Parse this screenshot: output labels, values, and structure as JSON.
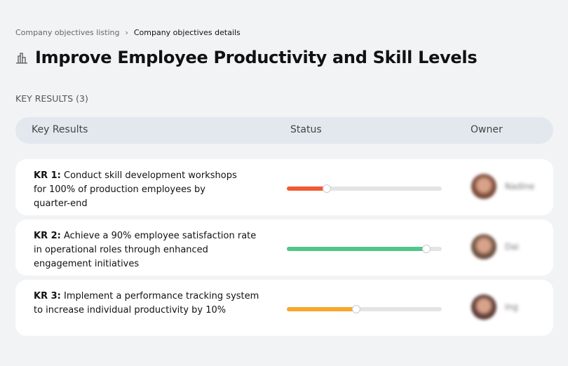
{
  "breadcrumb": {
    "items": [
      "Company objectives listing",
      "Company objectives details"
    ],
    "separator": "›"
  },
  "page": {
    "title": "Improve Employee Productivity and Skill Levels",
    "icon": "buildings-icon"
  },
  "key_results_count": "KEY RESULTS (3)",
  "table": {
    "headers": [
      "Key Results",
      "Status",
      "Owner"
    ],
    "rows": [
      {
        "label": "KR 1:",
        "text": "Conduct skill development workshops for 100% of production employees by quarter-end",
        "progress": 26,
        "color": "#f05a35",
        "owner": "Nadine",
        "avatar_color": "#7a4a3a"
      },
      {
        "label": "KR 2:",
        "text": "Achieve a 90% employee satisfaction rate in operational roles through enhanced engagement initiatives",
        "progress": 90,
        "color": "#52c58a",
        "owner": "Dai",
        "avatar_color": "#6b5040"
      },
      {
        "label": "KR 3:",
        "text": "Implement a performance tracking system to increase individual productivity by 10%",
        "progress": 45,
        "color": "#f9a62b",
        "owner": "Ing",
        "avatar_color": "#5a3a35"
      }
    ]
  }
}
